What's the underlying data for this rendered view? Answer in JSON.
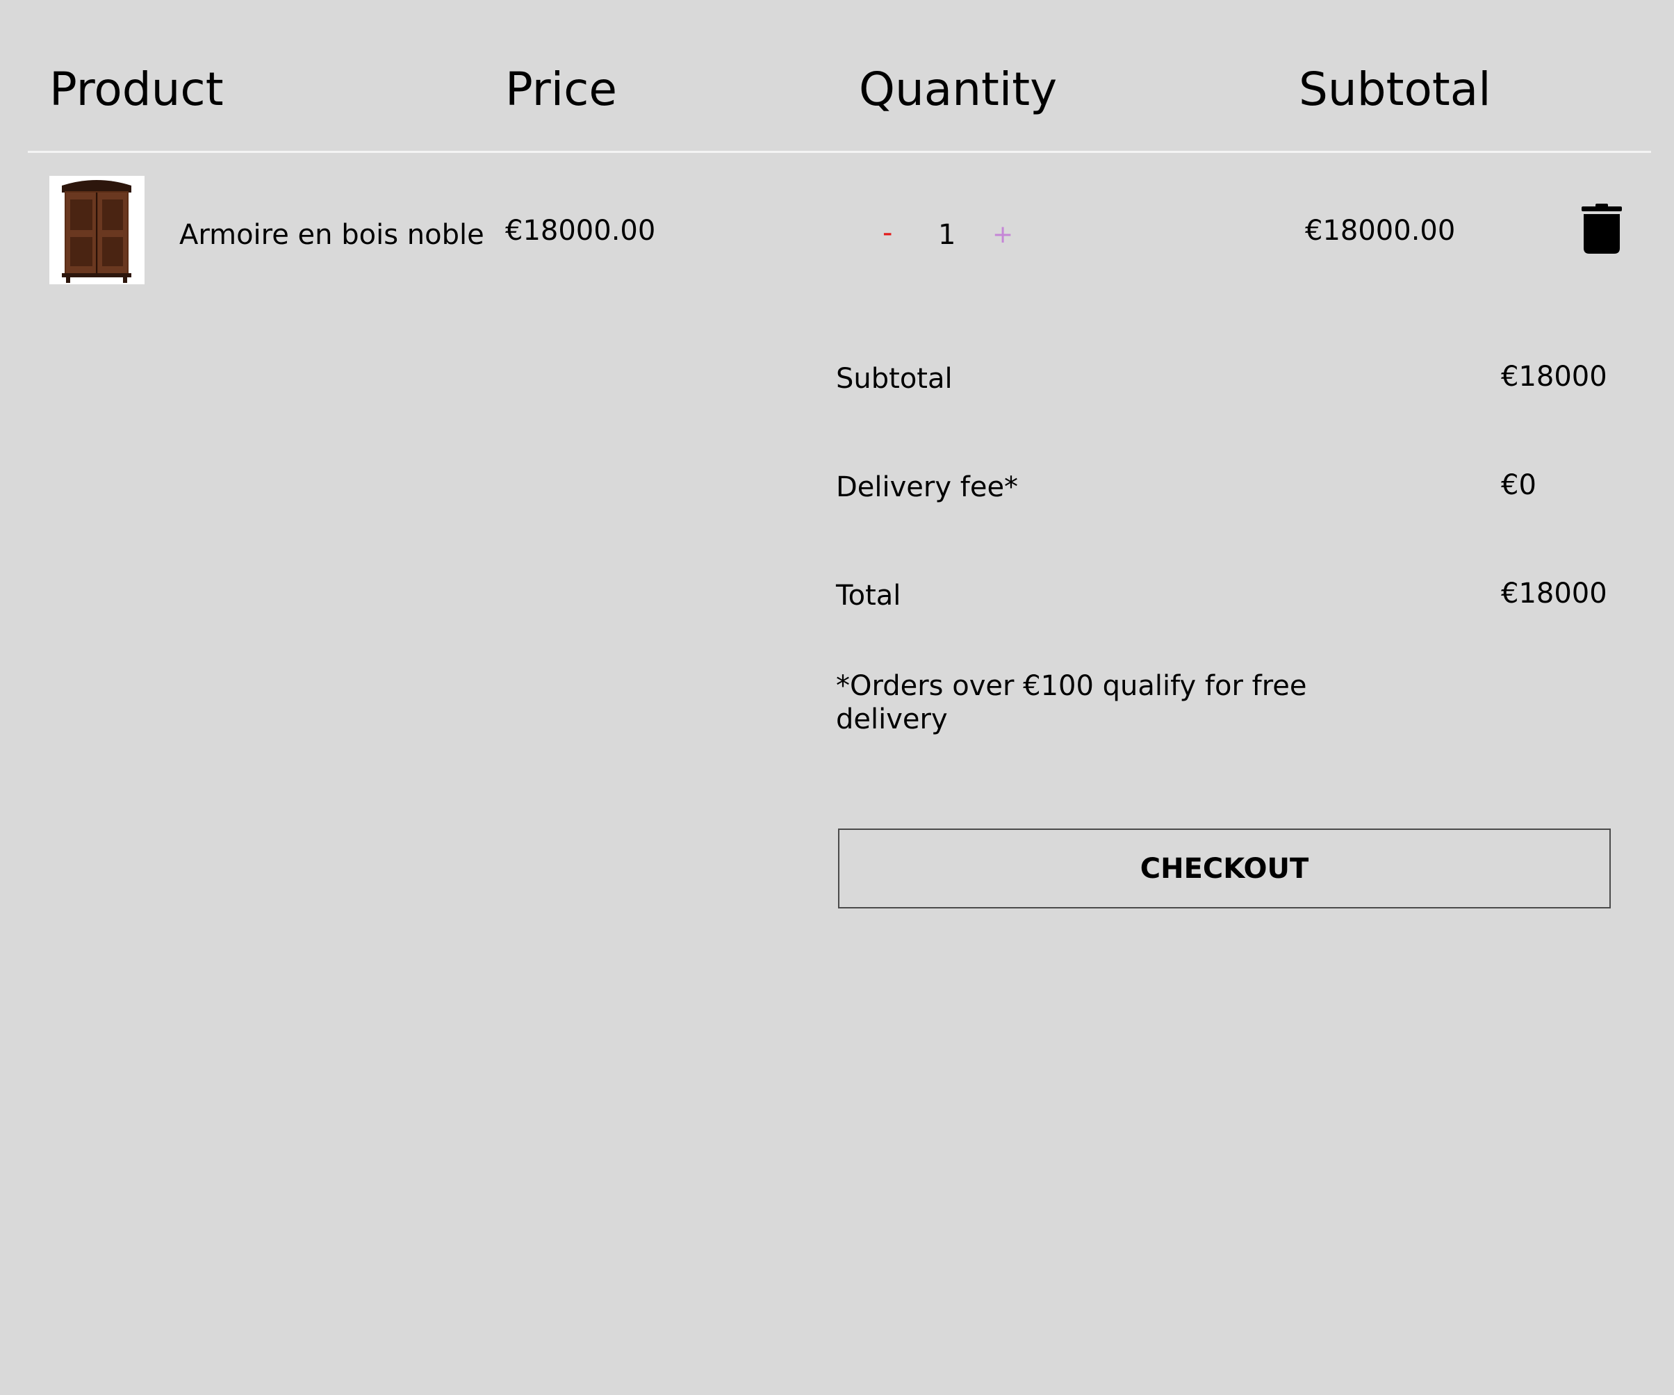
{
  "table": {
    "headers": {
      "product": "Product",
      "price": "Price",
      "quantity": "Quantity",
      "subtotal": "Subtotal"
    },
    "items": [
      {
        "name": "Armoire en bois noble",
        "price": "€18000.00",
        "quantity": "1",
        "minus": "-",
        "plus": "+",
        "subtotal": "€18000.00",
        "image_icon": "armoire-image",
        "delete_icon": "trash-icon"
      }
    ]
  },
  "summary": {
    "subtotal_label": "Subtotal",
    "subtotal_value": "€18000",
    "delivery_label": "Delivery fee*",
    "delivery_value": "€0",
    "total_label": "Total",
    "total_value": "€18000",
    "note": "*Orders over €100 qualify for free delivery",
    "checkout_label": "CHECKOUT"
  },
  "colors": {
    "background": "#d9d9d9",
    "minus": "#e21b1b",
    "plus": "#c586d6",
    "divider": "#f4f4f4"
  }
}
